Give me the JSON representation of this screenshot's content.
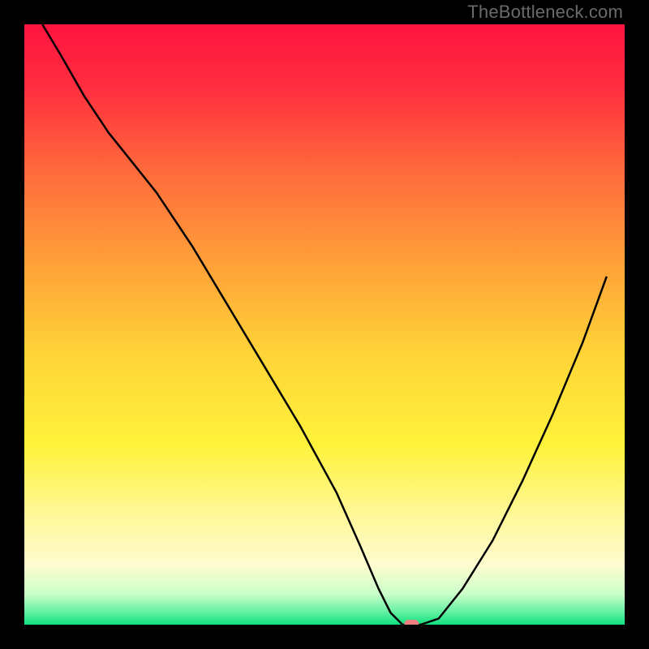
{
  "watermark": "TheBottleneck.com",
  "chart_data": {
    "type": "line",
    "title": "",
    "xlabel": "",
    "ylabel": "",
    "xlim": [
      0,
      100
    ],
    "ylim": [
      0,
      100
    ],
    "grid": false,
    "background": {
      "type": "vertical-gradient",
      "stops": [
        {
          "offset": 0.0,
          "color": "#FF143F"
        },
        {
          "offset": 0.1,
          "color": "#FF2C3F"
        },
        {
          "offset": 0.25,
          "color": "#FF6C3C"
        },
        {
          "offset": 0.4,
          "color": "#FFA138"
        },
        {
          "offset": 0.55,
          "color": "#FFD438"
        },
        {
          "offset": 0.7,
          "color": "#FFF23B"
        },
        {
          "offset": 0.82,
          "color": "#FFF89A"
        },
        {
          "offset": 0.9,
          "color": "#FFFCD0"
        },
        {
          "offset": 0.95,
          "color": "#C8FFC8"
        },
        {
          "offset": 0.98,
          "color": "#60F0A0"
        },
        {
          "offset": 1.0,
          "color": "#10E080"
        }
      ]
    },
    "series": [
      {
        "name": "bottleneck-curve",
        "color": "#000000",
        "x": [
          3,
          6,
          10,
          14,
          18,
          22,
          28,
          34,
          40,
          46,
          52,
          56,
          59,
          61,
          63,
          66,
          69,
          73,
          78,
          83,
          88,
          93,
          97
        ],
        "values": [
          100,
          95,
          88,
          82,
          77,
          72,
          63,
          53,
          43,
          33,
          22,
          13,
          6,
          2,
          0,
          0,
          1,
          6,
          14,
          24,
          35,
          47,
          58
        ]
      }
    ],
    "marker": {
      "name": "target-marker",
      "x": 64.5,
      "y": 0,
      "color": "#F08080",
      "shape": "rounded-pill"
    }
  }
}
